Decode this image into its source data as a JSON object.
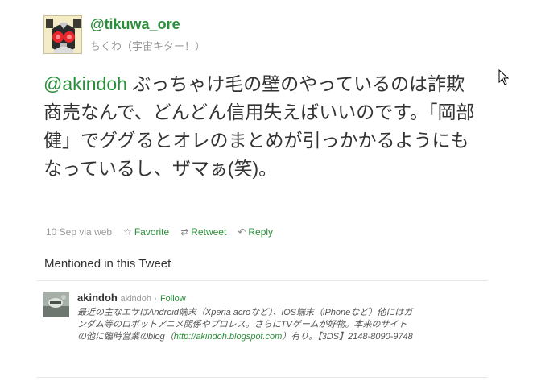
{
  "user": {
    "handle": "@tikuwa_ore",
    "name": "ちくわ（宇宙キター！）"
  },
  "tweet": {
    "mention": "@akindoh",
    "text": " ぶっちゃけ毛の壁のやっているのは詐欺商売なんで、どんどん信用失えばいいのです。「岡部健」でググるとオレのまとめが引っかかるようにもなっているし、ザマぁ(笑)。"
  },
  "meta": {
    "timestamp": "10 Sep",
    "via": "via web",
    "favorite_label": "Favorite",
    "retweet_label": "Retweet",
    "reply_label": "Reply"
  },
  "mentioned": {
    "section_title": "Mentioned in this Tweet",
    "name": "akindoh",
    "screen_name": "akindoh",
    "separator": "·",
    "follow_label": "Follow",
    "bio_before": "最近の主なエサはAndroid端末（Xperia acroなど）、iOS端末（iPhoneなど）他にはガンダム等のロボットアニメ関係やプロレス。さらにTVゲームが好物。本来のサイトの他に臨時営業のblog（",
    "bio_link": "http://akindoh.blogspot.com",
    "bio_after": "）有り。【3DS】2148-8090-9748"
  }
}
